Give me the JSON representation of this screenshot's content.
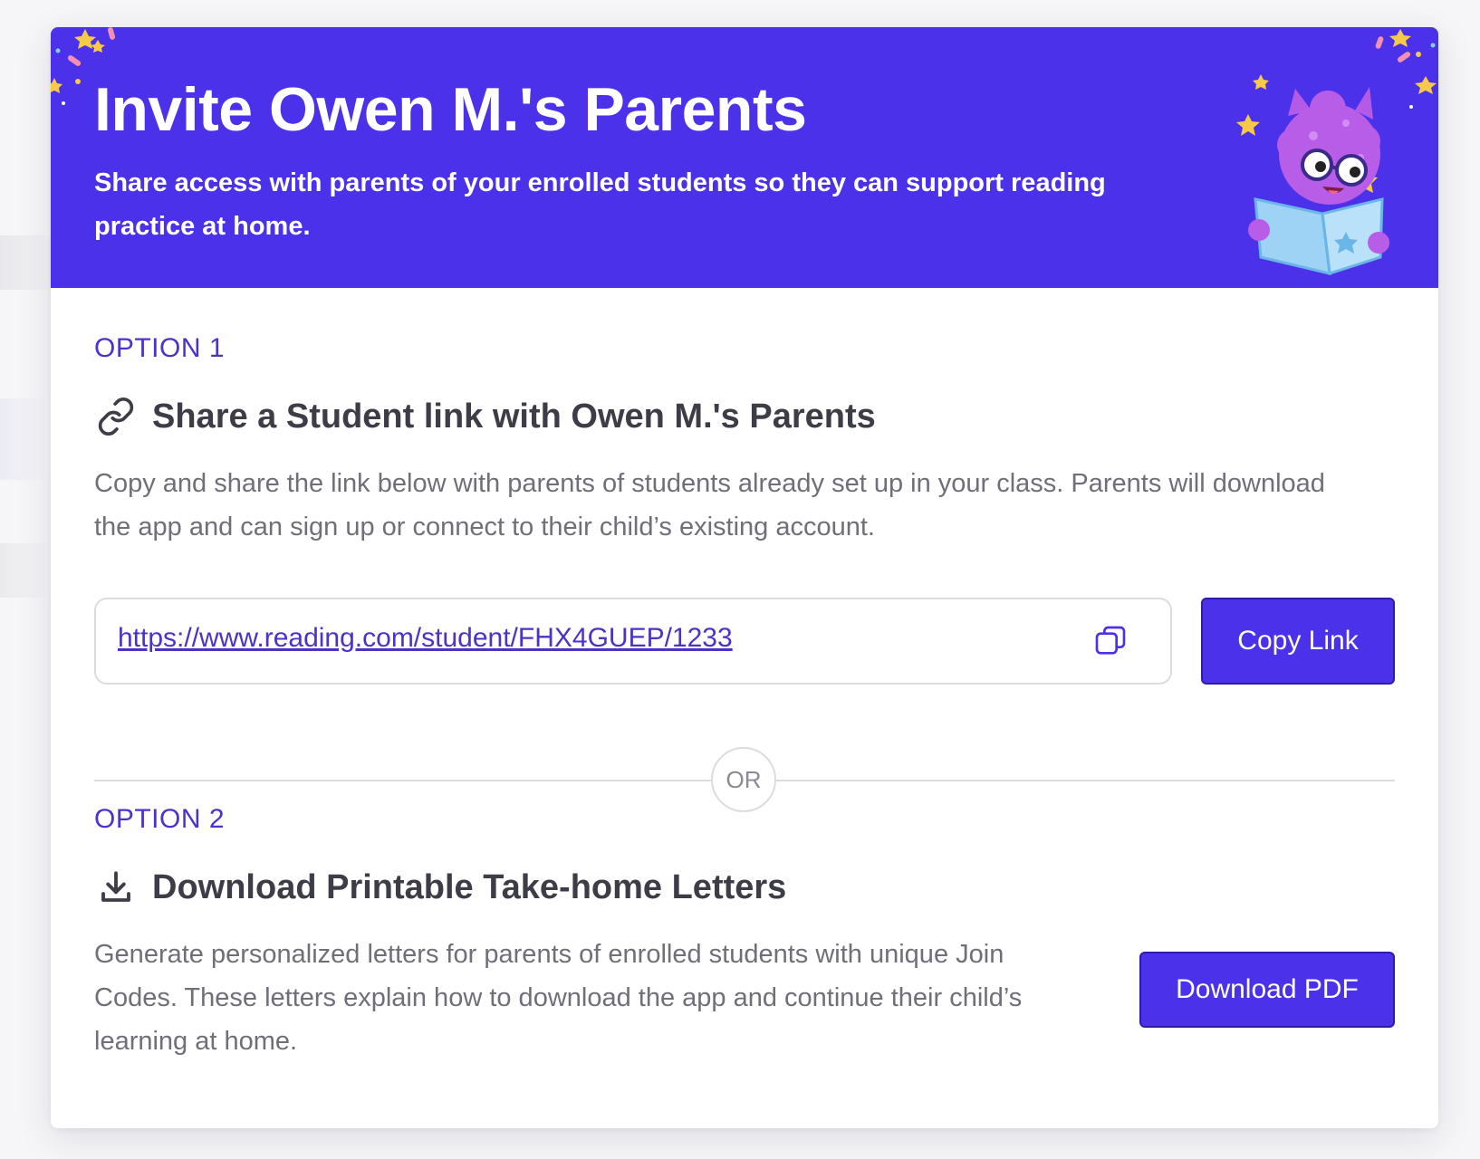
{
  "header": {
    "title": "Invite Owen M.'s Parents",
    "subtitle": "Share access with parents of your enrolled students so they can support reading practice at home."
  },
  "option1": {
    "label": "OPTION 1",
    "icon": "link-icon",
    "heading": "Share a Student link with Owen M.'s Parents",
    "description": "Copy and share the link below with parents of students already set up in your class. Parents will download the app and can sign up or connect to their child’s existing account.",
    "link_url": "https://www.reading.com/student/FHX4GUEP/1233",
    "copy_icon": "copy-icon",
    "button_label": "Copy Link"
  },
  "divider": {
    "label": "OR"
  },
  "option2": {
    "label": "OPTION 2",
    "icon": "download-icon",
    "heading": "Download Printable Take-home Letters",
    "description": "Generate personalized letters for parents of enrolled students with unique Join Codes. These letters explain how to download the app and continue their child’s learning at home.",
    "button_label": "Download PDF"
  },
  "colors": {
    "brand": "#4b32ea",
    "accent_text": "#4b32c8",
    "heading_text": "#3d3d47",
    "body_text": "#6f6f78"
  }
}
